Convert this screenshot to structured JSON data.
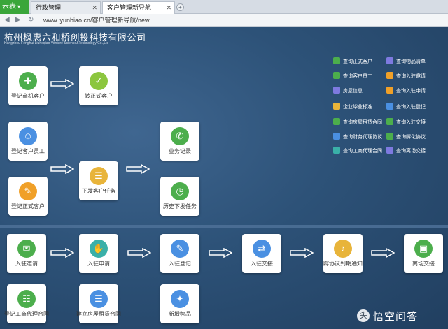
{
  "browser": {
    "brand_label": "云表",
    "tabs": [
      {
        "label": "行政管理"
      },
      {
        "label": "客户管理新导航"
      }
    ],
    "url": "www.iyunbiao.cn/客户管理新导航/new"
  },
  "app": {
    "company_cn": "杭州枫惠六和桥创投科技有限公司",
    "company_en": "Hangzhou Fenghui Liuheqiao Venture Science&Technology Co.,Ltd"
  },
  "cards": {
    "register_potential": "登记商机客户",
    "convert_formal": "转正式客户",
    "register_employee": "登记客户员工",
    "issue_task": "下发客户任务",
    "task_record": "业务记录",
    "register_formal": "登记正式客户",
    "history_tasks": "历史下发任务",
    "invite_settle": "入驻邀请",
    "settle_apply": "入驻申请",
    "settle_register": "入驻登记",
    "settle_handover": "入驻交接",
    "expire_notice": "孵协议到期通知",
    "leave_handover": "离场交接",
    "register_agency": "登记工商代理合同",
    "lease_contract": "建立房屋租赁合同",
    "new_items": "新增物品"
  },
  "quick_links": {
    "left": [
      "查询正式客户",
      "查询客户员工",
      "房屋信息",
      "企业毕业标准",
      "查询房屋租赁合同",
      "查询财务代理协议",
      "查询工商代理合同"
    ],
    "right": [
      "查询物品清单",
      "查询入驻邀请",
      "查询入驻申请",
      "查询入驻登记",
      "查询入驻交接",
      "查询孵化协议",
      "查询离场交接"
    ]
  },
  "watermark": {
    "badge": "头",
    "text": "悟空问答"
  },
  "colors": {
    "green": "#4cae4c",
    "lime": "#8cc63f",
    "teal": "#3ab0a8",
    "blue": "#4a90e2",
    "orange": "#f0a028",
    "gold": "#e8b43a",
    "purple": "#7e7ae0"
  }
}
